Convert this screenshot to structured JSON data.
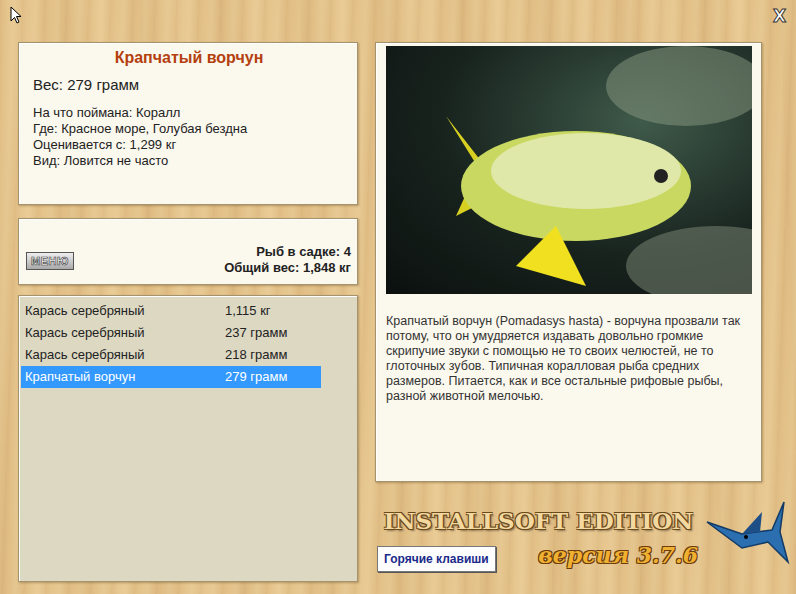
{
  "window": {
    "close": "X"
  },
  "fish_card": {
    "title": "Крапчатый ворчун",
    "weight": "Вес: 279 грамм",
    "details": [
      "На что поймана: Коралл",
      "Где: Красное море, Голубая бездна",
      "Оценивается с: 1,299 кг",
      "Вид: Ловится не часто"
    ]
  },
  "cage": {
    "menu_button": "МЕНЮ",
    "count": "Рыб в садке: 4",
    "total": "Общий вес: 1,848 кг"
  },
  "catch_list": [
    {
      "name": "Карась серебряный",
      "weight": "1,115 кг",
      "selected": false
    },
    {
      "name": "Карась серебряный",
      "weight": "237 грамм",
      "selected": false
    },
    {
      "name": "Карась серебряный",
      "weight": "218 грамм",
      "selected": false
    },
    {
      "name": "Крапчатый ворчун",
      "weight": "279 грамм",
      "selected": true
    }
  ],
  "description": "Крапчатый ворчун (Pomadasys hasta) - ворчуна прозвали так потому, что он умудряется издавать довольно громкие скрипучие звуки с помощью не то своих челюстей, не то глоточных зубов. Типичная коралловая рыба средних размеров. Питается, как и все остальные рифовые рыбы, разной животной мелочью.",
  "logo": {
    "title": "INSTALLSOFT EDITION",
    "version": "версия 3.7.6"
  },
  "hotkeys_button": "Горячие клавиши"
}
